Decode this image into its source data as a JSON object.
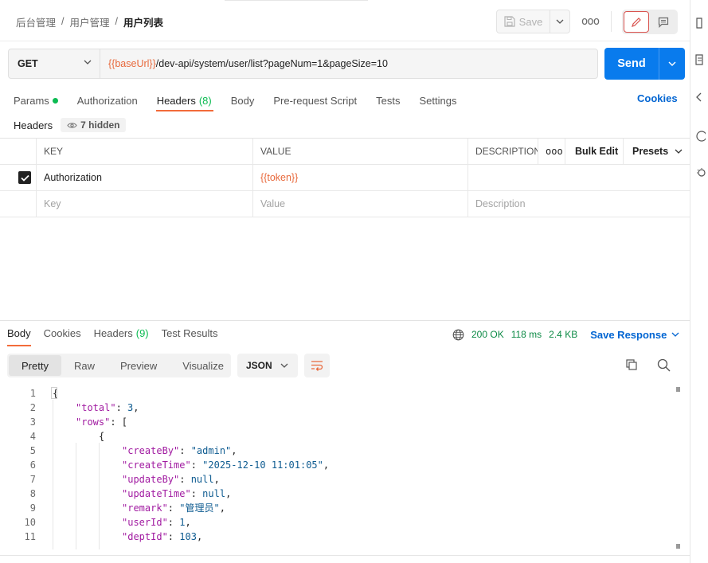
{
  "breadcrumb": [
    "后台管理",
    "用户管理",
    "用户列表"
  ],
  "toolbar": {
    "save_label": "Save",
    "more": "ooo"
  },
  "request": {
    "method": "GET",
    "url_var": "{{baseUrl}}",
    "url_rest": "/dev-api/system/user/list?pageNum=1&pageSize=10",
    "send_label": "Send"
  },
  "req_tabs": [
    {
      "label": "Params",
      "dot": true
    },
    {
      "label": "Authorization"
    },
    {
      "label": "Headers",
      "count": "(8)",
      "active": true
    },
    {
      "label": "Body"
    },
    {
      "label": "Pre-request Script"
    },
    {
      "label": "Tests"
    },
    {
      "label": "Settings"
    }
  ],
  "cookies_label": "Cookies",
  "headers_section": {
    "title": "Headers",
    "hidden": "7 hidden"
  },
  "headers_table": {
    "columns": [
      "KEY",
      "VALUE",
      "DESCRIPTION"
    ],
    "more": "ooo",
    "bulk_edit": "Bulk Edit",
    "presets": "Presets",
    "rows": [
      {
        "checked": true,
        "key": "Authorization",
        "value": "{{token}}",
        "description": ""
      }
    ],
    "placeholder": {
      "key": "Key",
      "value": "Value",
      "description": "Description"
    }
  },
  "resp_tabs": [
    {
      "label": "Body",
      "active": true
    },
    {
      "label": "Cookies"
    },
    {
      "label": "Headers",
      "count": "(9)"
    },
    {
      "label": "Test Results"
    }
  ],
  "response_meta": {
    "status": "200 OK",
    "time": "118 ms",
    "size": "2.4 KB",
    "save_response": "Save Response"
  },
  "view_tabs": [
    "Pretty",
    "Raw",
    "Preview",
    "Visualize"
  ],
  "format": "JSON",
  "code_lines": [
    {
      "n": "1",
      "indent": 0,
      "parts": [
        [
          "p",
          "{"
        ]
      ]
    },
    {
      "n": "2",
      "indent": 1,
      "parts": [
        [
          "k",
          "\"total\""
        ],
        [
          "p",
          ": "
        ],
        [
          "n",
          "3"
        ],
        [
          "p",
          ","
        ]
      ]
    },
    {
      "n": "3",
      "indent": 1,
      "parts": [
        [
          "k",
          "\"rows\""
        ],
        [
          "p",
          ": ["
        ]
      ]
    },
    {
      "n": "4",
      "indent": 2,
      "parts": [
        [
          "p",
          "{"
        ]
      ]
    },
    {
      "n": "5",
      "indent": 3,
      "parts": [
        [
          "k",
          "\"createBy\""
        ],
        [
          "p",
          ": "
        ],
        [
          "s",
          "\"admin\""
        ],
        [
          "p",
          ","
        ]
      ]
    },
    {
      "n": "6",
      "indent": 3,
      "parts": [
        [
          "k",
          "\"createTime\""
        ],
        [
          "p",
          ": "
        ],
        [
          "s",
          "\"2025-12-10 11:01:05\""
        ],
        [
          "p",
          ","
        ]
      ]
    },
    {
      "n": "7",
      "indent": 3,
      "parts": [
        [
          "k",
          "\"updateBy\""
        ],
        [
          "p",
          ": "
        ],
        [
          "kw",
          "null"
        ],
        [
          "p",
          ","
        ]
      ]
    },
    {
      "n": "8",
      "indent": 3,
      "parts": [
        [
          "k",
          "\"updateTime\""
        ],
        [
          "p",
          ": "
        ],
        [
          "kw",
          "null"
        ],
        [
          "p",
          ","
        ]
      ]
    },
    {
      "n": "9",
      "indent": 3,
      "parts": [
        [
          "k",
          "\"remark\""
        ],
        [
          "p",
          ": "
        ],
        [
          "s",
          "\"管理员\""
        ],
        [
          "p",
          ","
        ]
      ]
    },
    {
      "n": "10",
      "indent": 3,
      "parts": [
        [
          "k",
          "\"userId\""
        ],
        [
          "p",
          ": "
        ],
        [
          "n",
          "1"
        ],
        [
          "p",
          ","
        ]
      ]
    },
    {
      "n": "11",
      "indent": 3,
      "parts": [
        [
          "k",
          "\"deptId\""
        ],
        [
          "p",
          ": "
        ],
        [
          "n",
          "103"
        ],
        [
          "p",
          ","
        ]
      ]
    }
  ]
}
